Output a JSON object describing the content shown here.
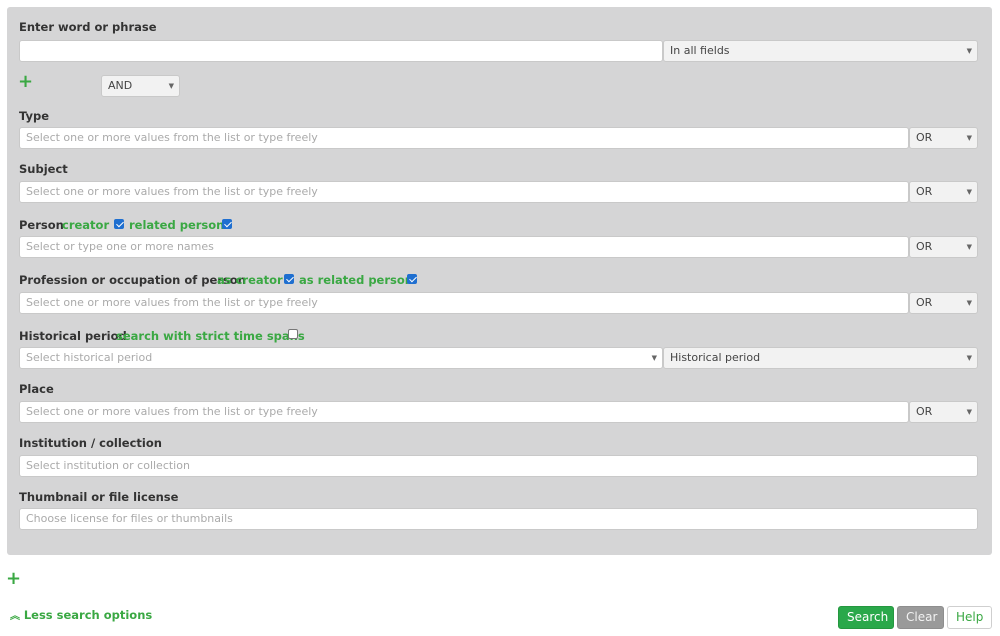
{
  "search": {
    "phrase_label": "Enter word or phrase",
    "phrase_value": "",
    "field_scope": "In all fields",
    "operator": "AND"
  },
  "fields": {
    "type": {
      "label": "Type",
      "placeholder": "Select one or more values from the list or type freely",
      "operator": "OR"
    },
    "subject": {
      "label": "Subject",
      "placeholder": "Select one or more values from the list or type freely",
      "operator": "OR"
    },
    "person": {
      "label": "Person",
      "opt1_label": "creator",
      "opt1_checked": true,
      "opt2_label": "related person",
      "opt2_checked": true,
      "placeholder": "Select or type one or more names",
      "operator": "OR"
    },
    "profession": {
      "label": "Profession or occupation of person",
      "opt1_label": "as creator",
      "opt1_checked": true,
      "opt2_label": "as related person",
      "opt2_checked": true,
      "placeholder": "Select one or more values from the list or type freely",
      "operator": "OR"
    },
    "period": {
      "label": "Historical period",
      "opt_label": "search with strict time spans",
      "opt_checked": false,
      "placeholder": "Select historical period",
      "type_select": "Historical period"
    },
    "place": {
      "label": "Place",
      "placeholder": "Select one or more values from the list or type freely",
      "operator": "OR"
    },
    "institution": {
      "label": "Institution / collection",
      "placeholder": "Select institution or collection"
    },
    "license": {
      "label": "Thumbnail or file license",
      "placeholder": "Choose license for files or thumbnails"
    }
  },
  "footer": {
    "less_options": "Less search options",
    "search_button": "Search",
    "clear_button": "Clear",
    "help_button": "Help"
  },
  "colors": {
    "accent_green": "#3aa843",
    "search_button": "#2aa84a",
    "clear_button": "#9a9a9a",
    "panel": "#d5d5d6"
  }
}
